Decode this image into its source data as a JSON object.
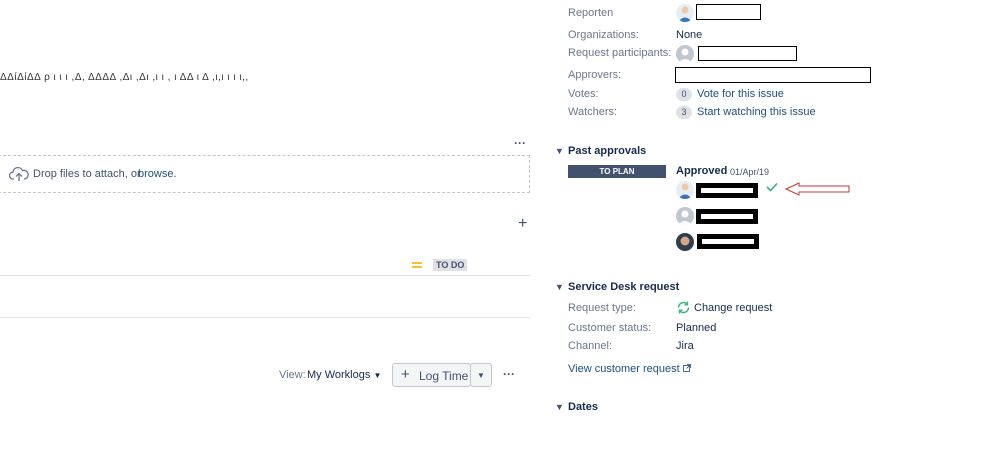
{
  "left": {
    "garbled_text": "ΔΔίΔίΔΔ  ρ  ι  ι ι  ,Δ,  ΔΔΔΔ  ,Δι  ,Δι ,ι  ι  , ι  ΔΔ ι  Δ   ,ι,ι  ι  ι ι,,",
    "attach_drop_text": "Drop files to attach, or",
    "attach_browse_link": "browse.",
    "more_dots": "···",
    "add_plus": "+",
    "priority_icon": "medium-priority-icon",
    "status_badge": "TO DO",
    "worklog": {
      "view_label": "View:",
      "view_value": "My Worklogs",
      "log_time_label": "Log Time",
      "more_dots": "···"
    }
  },
  "people": {
    "reporter_label": "Reporten",
    "organizations_label": "Organizations:",
    "organizations_value": "None",
    "participants_label": "Request participants:",
    "approvers_label": "Approvers:",
    "votes_label": "Votes:",
    "votes_count": "0",
    "votes_link": "Vote for this issue",
    "watchers_label": "Watchers:",
    "watchers_count": "3",
    "watchers_link": "Start watching this issue"
  },
  "past_approvals": {
    "title": "Past approvals",
    "status_lozenge": "TO PLAN",
    "approved_label": "Approved",
    "approved_date": "01/Apr/19"
  },
  "service_desk": {
    "title": "Service Desk request",
    "request_type_label": "Request type:",
    "request_type_value": "Change request",
    "customer_status_label": "Customer status:",
    "customer_status_value": "Planned",
    "channel_label": "Channel:",
    "channel_value": "Jira",
    "view_link": "View customer request"
  },
  "dates": {
    "title": "Dates"
  },
  "colors": {
    "link": "#205081",
    "lozenge_bg": "#42526e",
    "check": "#36b37e",
    "arrow": "#c0392b"
  }
}
